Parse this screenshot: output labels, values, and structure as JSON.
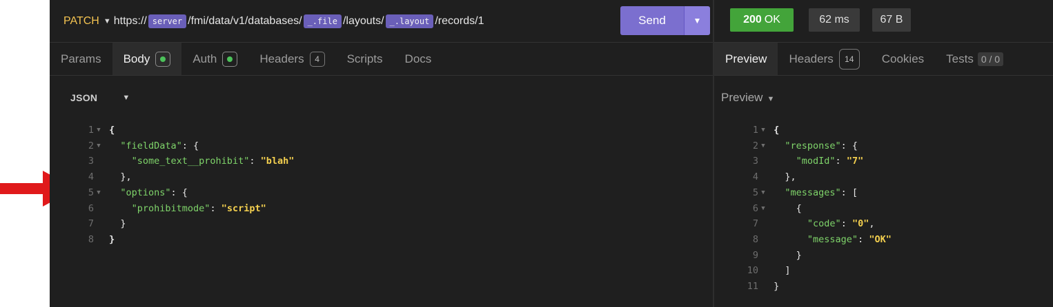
{
  "request": {
    "method": "PATCH",
    "url_parts": [
      {
        "type": "text",
        "value": "https://"
      },
      {
        "type": "var",
        "value": "server"
      },
      {
        "type": "text",
        "value": "/fmi/data/v1/databases/"
      },
      {
        "type": "var",
        "value": "_.file"
      },
      {
        "type": "text",
        "value": "/layouts/"
      },
      {
        "type": "var",
        "value": "_.layout"
      },
      {
        "type": "text",
        "value": "/records/1"
      }
    ],
    "send_label": "Send",
    "tabs": [
      {
        "name": "params",
        "label": "Params",
        "active": false
      },
      {
        "name": "body",
        "label": "Body",
        "active": true,
        "dot": true
      },
      {
        "name": "auth",
        "label": "Auth",
        "active": false,
        "dot": true
      },
      {
        "name": "headers",
        "label": "Headers",
        "active": false,
        "count": "4"
      },
      {
        "name": "scripts",
        "label": "Scripts",
        "active": false
      },
      {
        "name": "docs",
        "label": "Docs",
        "active": false
      }
    ],
    "body_format": "JSON",
    "body_lines": [
      {
        "n": "1",
        "fold": true,
        "indent": 0,
        "tokens": [
          [
            "p",
            "{"
          ]
        ]
      },
      {
        "n": "2",
        "fold": true,
        "indent": 1,
        "tokens": [
          [
            "k",
            "\"fieldData\""
          ],
          [
            "src",
            ": {"
          ]
        ]
      },
      {
        "n": "3",
        "fold": false,
        "indent": 2,
        "tokens": [
          [
            "k",
            "\"some_text__prohibit\""
          ],
          [
            "src",
            ": "
          ],
          [
            "s",
            "\"blah\""
          ]
        ]
      },
      {
        "n": "4",
        "fold": false,
        "indent": 1,
        "tokens": [
          [
            "src",
            "},"
          ]
        ]
      },
      {
        "n": "5",
        "fold": true,
        "indent": 1,
        "tokens": [
          [
            "k",
            "\"options\""
          ],
          [
            "src",
            ": {"
          ]
        ]
      },
      {
        "n": "6",
        "fold": false,
        "indent": 2,
        "tokens": [
          [
            "k",
            "\"prohibitmode\""
          ],
          [
            "src",
            ": "
          ],
          [
            "s",
            "\"script\""
          ]
        ]
      },
      {
        "n": "7",
        "fold": false,
        "indent": 1,
        "tokens": [
          [
            "src",
            "}"
          ]
        ]
      },
      {
        "n": "8",
        "fold": false,
        "indent": 0,
        "tokens": [
          [
            "p",
            "}"
          ]
        ]
      }
    ]
  },
  "response": {
    "status_code": "200",
    "status_text": "OK",
    "time": "62 ms",
    "size": "67 B",
    "tabs": [
      {
        "name": "preview",
        "label": "Preview",
        "active": true
      },
      {
        "name": "headers",
        "label": "Headers",
        "active": false,
        "count": "14"
      },
      {
        "name": "cookies",
        "label": "Cookies",
        "active": false
      },
      {
        "name": "tests",
        "label": "Tests",
        "active": false,
        "tests": "0 / 0"
      }
    ],
    "preview_mode": "Preview",
    "body_lines": [
      {
        "n": "1",
        "fold": true,
        "indent": 0,
        "tokens": [
          [
            "p",
            "{"
          ]
        ]
      },
      {
        "n": "2",
        "fold": true,
        "indent": 1,
        "tokens": [
          [
            "k",
            "\"response\""
          ],
          [
            "src",
            ": {"
          ]
        ]
      },
      {
        "n": "3",
        "fold": false,
        "indent": 2,
        "tokens": [
          [
            "k",
            "\"modId\""
          ],
          [
            "src",
            ": "
          ],
          [
            "s",
            "\"7\""
          ]
        ]
      },
      {
        "n": "4",
        "fold": false,
        "indent": 1,
        "tokens": [
          [
            "src",
            "},"
          ]
        ]
      },
      {
        "n": "5",
        "fold": true,
        "indent": 1,
        "tokens": [
          [
            "k",
            "\"messages\""
          ],
          [
            "src",
            ": ["
          ]
        ]
      },
      {
        "n": "6",
        "fold": true,
        "indent": 2,
        "tokens": [
          [
            "src",
            "{"
          ]
        ]
      },
      {
        "n": "7",
        "fold": false,
        "indent": 3,
        "tokens": [
          [
            "k",
            "\"code\""
          ],
          [
            "src",
            ": "
          ],
          [
            "s",
            "\"0\""
          ],
          [
            "src",
            ","
          ]
        ]
      },
      {
        "n": "8",
        "fold": false,
        "indent": 3,
        "tokens": [
          [
            "k",
            "\"message\""
          ],
          [
            "src",
            ": "
          ],
          [
            "s",
            "\"OK\""
          ]
        ]
      },
      {
        "n": "9",
        "fold": false,
        "indent": 2,
        "tokens": [
          [
            "src",
            "}"
          ]
        ]
      },
      {
        "n": "10",
        "fold": false,
        "indent": 1,
        "tokens": [
          [
            "src",
            "]"
          ]
        ]
      },
      {
        "n": "11",
        "fold": false,
        "indent": 0,
        "tokens": [
          [
            "src",
            "}"
          ]
        ]
      }
    ]
  },
  "annotation": {
    "arrow_color": "#e0191b"
  },
  "colors": {
    "accent": "#7b6fcf",
    "ok": "#43a43a",
    "method": "#f5c451"
  }
}
